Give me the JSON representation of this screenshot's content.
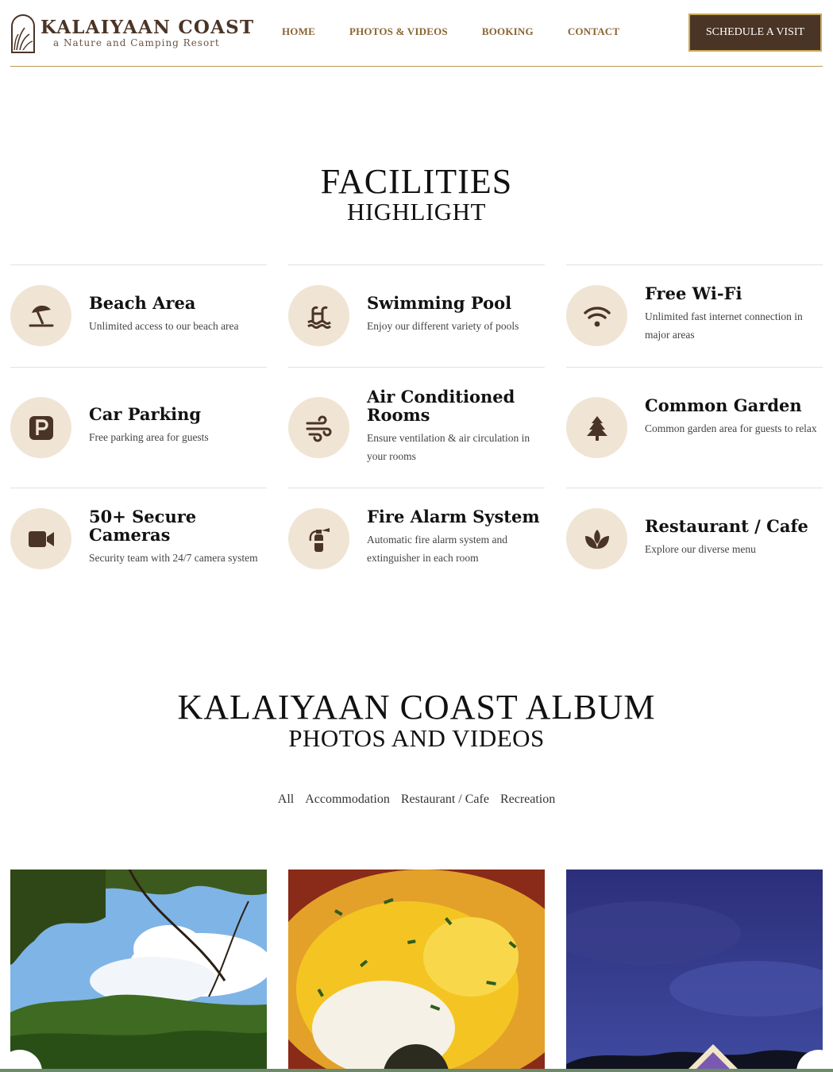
{
  "brand": {
    "name": "KALAIYAAN COAST",
    "tagline": "a Nature and Camping Resort"
  },
  "nav": {
    "items": [
      {
        "label": "HOME"
      },
      {
        "label": "PHOTOS & VIDEOS"
      },
      {
        "label": "BOOKING"
      },
      {
        "label": "CONTACT"
      }
    ],
    "cta_label": "SCHEDULE A VISIT"
  },
  "facilities": {
    "title": "FACILITIES",
    "subtitle": "HIGHLIGHT",
    "items": [
      {
        "title": "Beach Area",
        "desc": "Unlimited access to our beach area",
        "icon": "umbrella-beach-icon"
      },
      {
        "title": "Swimming Pool",
        "desc": "Enjoy our different variety of pools",
        "icon": "swimming-pool-icon"
      },
      {
        "title": "Free Wi-Fi",
        "desc": "Unlimited fast internet connection in major areas",
        "icon": "wifi-icon"
      },
      {
        "title": "Car Parking",
        "desc": "Free parking area for guests",
        "icon": "parking-icon"
      },
      {
        "title": "Air Conditioned Rooms",
        "desc": "Ensure ventilation & air circulation in your rooms",
        "icon": "wind-icon"
      },
      {
        "title": "Common Garden",
        "desc": "Common garden area for guests to relax",
        "icon": "tree-icon"
      },
      {
        "title": "50+ Secure Cameras",
        "desc": "Security team with 24/7 camera system",
        "icon": "video-camera-icon"
      },
      {
        "title": "Fire Alarm System",
        "desc": "Automatic fire alarm system and extinguisher in each room",
        "icon": "fire-extinguisher-icon"
      },
      {
        "title": "Restaurant / Cafe",
        "desc": "Explore our diverse menu",
        "icon": "lotus-icon"
      }
    ]
  },
  "album": {
    "title": "KALAIYAAN COAST ALBUM",
    "subtitle": "PHOTOS AND VIDEOS",
    "filters": [
      "All",
      "Accommodation",
      "Restaurant / Cafe",
      "Recreation"
    ]
  },
  "colors": {
    "brand_brown": "#4a3426",
    "nav_gold": "#8a6433",
    "accent_gold": "#c9a85c",
    "icon_bg": "#f0e4d4"
  }
}
